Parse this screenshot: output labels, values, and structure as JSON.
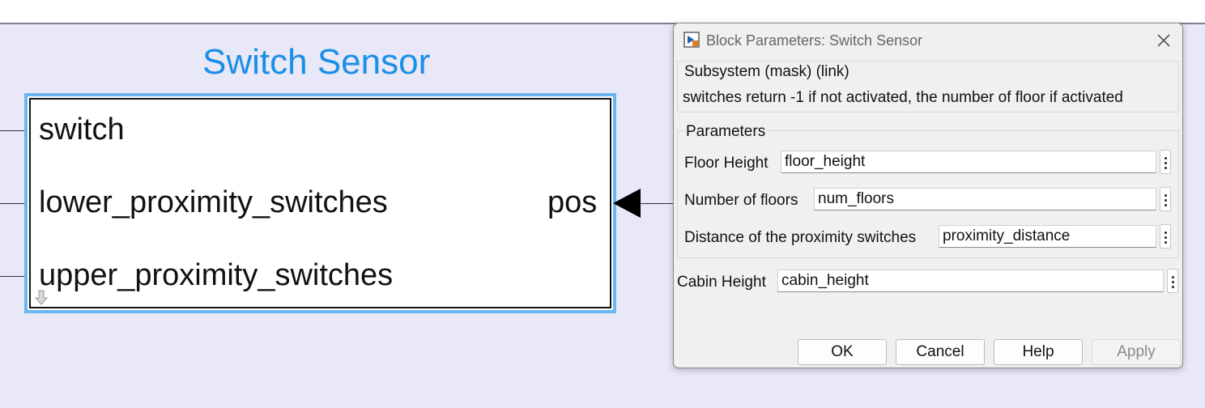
{
  "block": {
    "title": "Switch Sensor",
    "inputs": [
      "switch",
      "lower_proximity_switches",
      "upper_proximity_switches"
    ],
    "output": "pos"
  },
  "dialog": {
    "title": "Block Parameters: Switch Sensor",
    "subsystem_header": "Subsystem (mask) (link)",
    "description": "switches return -1 if not activated, the number of floor if activated",
    "parameters_header": "Parameters",
    "params": [
      {
        "label": "Floor Height",
        "value": "floor_height"
      },
      {
        "label": "Number of floors",
        "value": "num_floors"
      },
      {
        "label": "Distance of the proximity switches",
        "value": "proximity_distance"
      },
      {
        "label": "Cabin Height",
        "value": "cabin_height"
      }
    ],
    "buttons": {
      "ok": "OK",
      "cancel": "Cancel",
      "help": "Help",
      "apply": "Apply"
    }
  },
  "icons": [
    "simulink-block-icon",
    "close-icon",
    "kebab-menu-icon",
    "expand-down-arrow-icon"
  ]
}
